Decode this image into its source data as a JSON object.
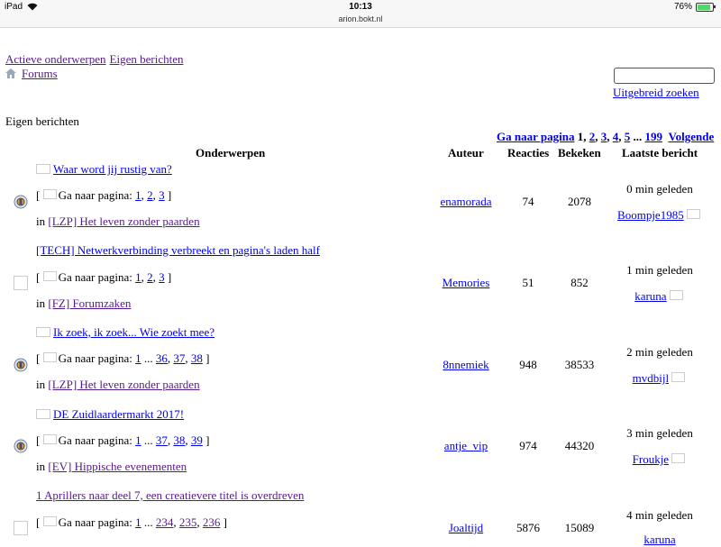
{
  "statusbar": {
    "device": "iPad",
    "time": "10:13",
    "url": "arion.bokt.nl",
    "battery": "76%"
  },
  "nav": {
    "active_topics": "Actieve onderwerpen",
    "own_posts": "Eigen berichten"
  },
  "breadcrumb": {
    "forums": "Forums"
  },
  "search": {
    "advanced": "Uitgebreid zoeken",
    "value": ""
  },
  "page_title": "Eigen berichten",
  "pager": {
    "goto": "Ga naar pagina",
    "current": "1",
    "pages": [
      "2",
      "3",
      "4",
      "5"
    ],
    "ellipsis": "...",
    "last": "199",
    "next": "Volgende"
  },
  "table": {
    "headers": {
      "topics": "Onderwerpen",
      "author": "Auteur",
      "replies": "Reacties",
      "views": "Bekeken",
      "last_post": "Laatste bericht"
    },
    "goto_label": "Ga naar pagina:",
    "in_label": "in",
    "rows": [
      {
        "title": "Waar word jij rustig van?",
        "pages": [
          "1",
          "2",
          "3"
        ],
        "forum": "[LZP] Het leven zonder paarden",
        "author": "enamorada",
        "replies": "74",
        "views": "2078",
        "last_time": "0 min geleden",
        "last_user": "Boompje1985"
      },
      {
        "title": "[TECH] Netwerkverbinding verbreekt en pagina's laden half",
        "pages": [
          "1",
          "2",
          "3"
        ],
        "forum": "[FZ] Forumzaken",
        "author": "Memories",
        "replies": "51",
        "views": "852",
        "last_time": "1 min geleden",
        "last_user": "karuna"
      },
      {
        "title": "Ik zoek, ik zoek... Wie zoekt mee?",
        "pages": [
          "1",
          "...",
          "36",
          "37",
          "38"
        ],
        "forum": "[LZP] Het leven zonder paarden",
        "author": "8nnemiek",
        "replies": "948",
        "views": "38533",
        "last_time": "2 min geleden",
        "last_user": "mvdbijl"
      },
      {
        "title": "DE Zuidlaardermarkt 2017!",
        "pages": [
          "1",
          "...",
          "37",
          "38",
          "39"
        ],
        "forum": "[EV] Hippische evenementen",
        "author": "antje_vip",
        "replies": "974",
        "views": "44320",
        "last_time": "3 min geleden",
        "last_user": "Froukje"
      },
      {
        "title": "1 Aprillers naar deel 7, een creatievere titel is overdreven",
        "pages": [
          "1",
          "...",
          "234",
          "235",
          "236"
        ],
        "forum": "",
        "author": "Joaltijd",
        "replies": "5876",
        "views": "15089",
        "last_time": "4 min geleden",
        "last_user": "karuna"
      }
    ]
  }
}
